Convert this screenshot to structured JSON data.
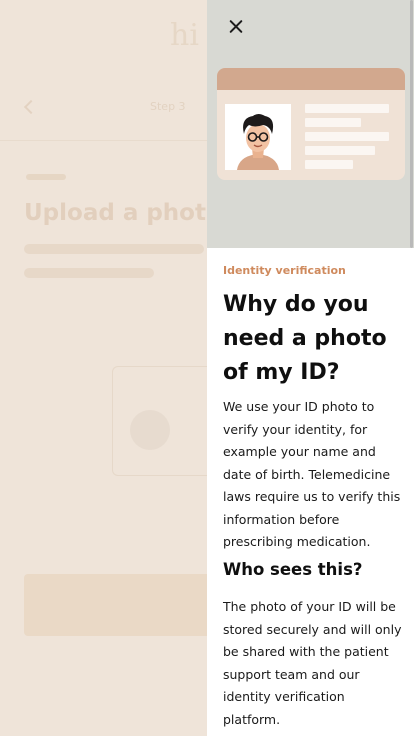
{
  "background": {
    "brand": "hi",
    "step": "Step 3"
  },
  "drawer": {
    "close_icon": "close-icon",
    "illustration": "id-card-illustration",
    "eyebrow": "Identity verification",
    "title": "Why do you need a photo of my ID?",
    "paragraph1": "We use your ID photo to verify your identity, for example your name and date of birth. Telemedicine laws require us to verify this information before prescribing medication.",
    "subtitle": "Who sees this?",
    "paragraph2": "The photo of your ID will be stored securely and will only be shared with the patient support team and our identity verification platform."
  },
  "colors": {
    "accent": "#cf8a5d",
    "overlay": "#efe4d9",
    "hero": "#d8d9d3",
    "card": "#f0e2d6",
    "card_band": "#d2a88e"
  }
}
